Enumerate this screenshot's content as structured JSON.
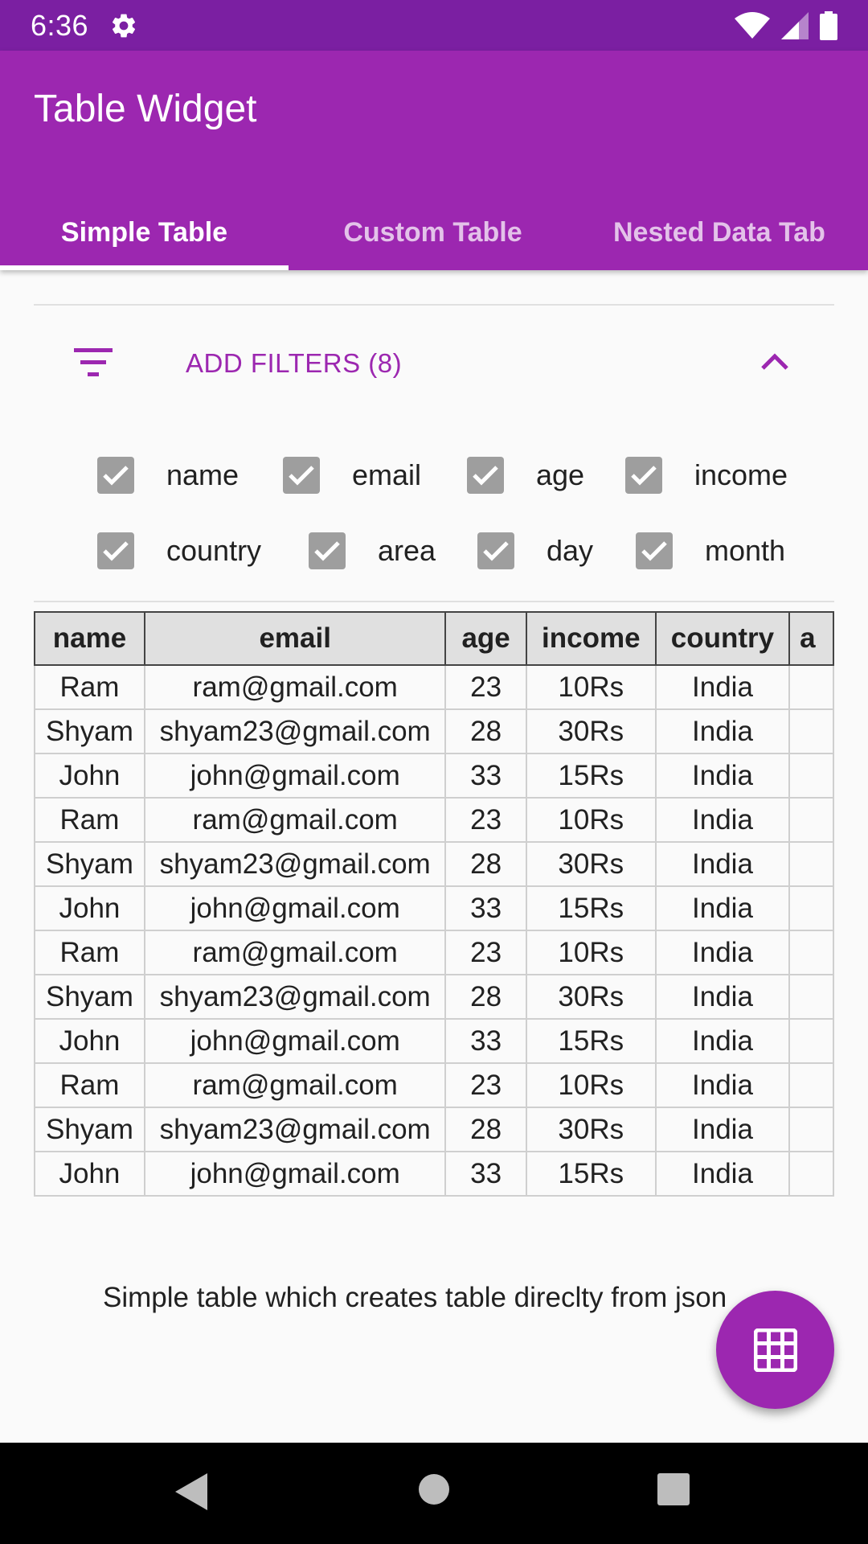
{
  "status_bar": {
    "time": "6:36",
    "icons": [
      "gear-icon",
      "wifi-icon",
      "signal-icon",
      "battery-icon"
    ]
  },
  "app_bar": {
    "title": "Table Widget",
    "tabs": [
      {
        "label": "Simple Table",
        "active": true
      },
      {
        "label": "Custom Table",
        "active": false
      },
      {
        "label": "Nested Data Tab",
        "active": false
      }
    ]
  },
  "filters": {
    "label": "ADD FILTERS (8)",
    "items": [
      {
        "label": "name",
        "checked": true
      },
      {
        "label": "email",
        "checked": true
      },
      {
        "label": "age",
        "checked": true
      },
      {
        "label": "income",
        "checked": true
      },
      {
        "label": "country",
        "checked": true
      },
      {
        "label": "area",
        "checked": true
      },
      {
        "label": "day",
        "checked": true
      },
      {
        "label": "month",
        "checked": true
      }
    ]
  },
  "table": {
    "columns": [
      "name",
      "email",
      "age",
      "income",
      "country",
      "a"
    ],
    "rows": [
      [
        "Ram",
        "ram@gmail.com",
        "23",
        "10Rs",
        "India"
      ],
      [
        "Shyam",
        "shyam23@gmail.com",
        "28",
        "30Rs",
        "India"
      ],
      [
        "John",
        "john@gmail.com",
        "33",
        "15Rs",
        "India"
      ],
      [
        "Ram",
        "ram@gmail.com",
        "23",
        "10Rs",
        "India"
      ],
      [
        "Shyam",
        "shyam23@gmail.com",
        "28",
        "30Rs",
        "India"
      ],
      [
        "John",
        "john@gmail.com",
        "33",
        "15Rs",
        "India"
      ],
      [
        "Ram",
        "ram@gmail.com",
        "23",
        "10Rs",
        "India"
      ],
      [
        "Shyam",
        "shyam23@gmail.com",
        "28",
        "30Rs",
        "India"
      ],
      [
        "John",
        "john@gmail.com",
        "33",
        "15Rs",
        "India"
      ],
      [
        "Ram",
        "ram@gmail.com",
        "23",
        "10Rs",
        "India"
      ],
      [
        "Shyam",
        "shyam23@gmail.com",
        "28",
        "30Rs",
        "India"
      ],
      [
        "John",
        "john@gmail.com",
        "33",
        "15Rs",
        "India"
      ]
    ]
  },
  "caption": "Simple table which creates table direclty from json",
  "fab": {
    "icon": "grid-icon"
  },
  "colors": {
    "primary": "#9c27b0",
    "primary_dark": "#7b1fa2",
    "checkbox": "#9e9e9e"
  }
}
